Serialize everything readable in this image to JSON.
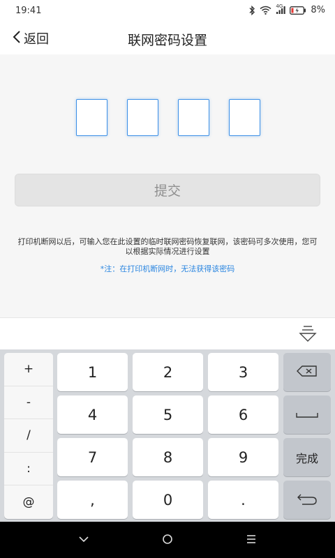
{
  "status_bar": {
    "time": "19:41",
    "network_label": "4G",
    "battery": "8%"
  },
  "nav": {
    "back_label": "返回",
    "title": "联网密码设置"
  },
  "pin": {
    "digits": 4
  },
  "submit_label": "提交",
  "description": "打印机断网以后，可输入您在此设置的临时联网密码恢复联网，该密码可多次使用，您可以根据实际情况进行设置",
  "note": "*注：在打印机断网时，无法获得该密码",
  "keyboard": {
    "symbols": [
      "+",
      "-",
      "/",
      ":",
      "@"
    ],
    "rows": [
      [
        "1",
        "2",
        "3"
      ],
      [
        "4",
        "5",
        "6"
      ],
      [
        "7",
        "8",
        "9"
      ],
      [
        ",",
        "0",
        "."
      ]
    ],
    "done_label": "完成"
  },
  "icons": {
    "back": "chevron-left-icon",
    "hide_keyboard": "keyboard-hide-icon",
    "backspace": "backspace-icon",
    "space": "space-icon",
    "enter": "enter-icon",
    "nav_back": "chevron-down-icon",
    "nav_home": "circle-icon",
    "nav_menu": "menu-icon"
  },
  "colors": {
    "accent": "#2b86e0",
    "pin_border": "#3a8ee6",
    "button_bg": "#e4e4e4"
  }
}
